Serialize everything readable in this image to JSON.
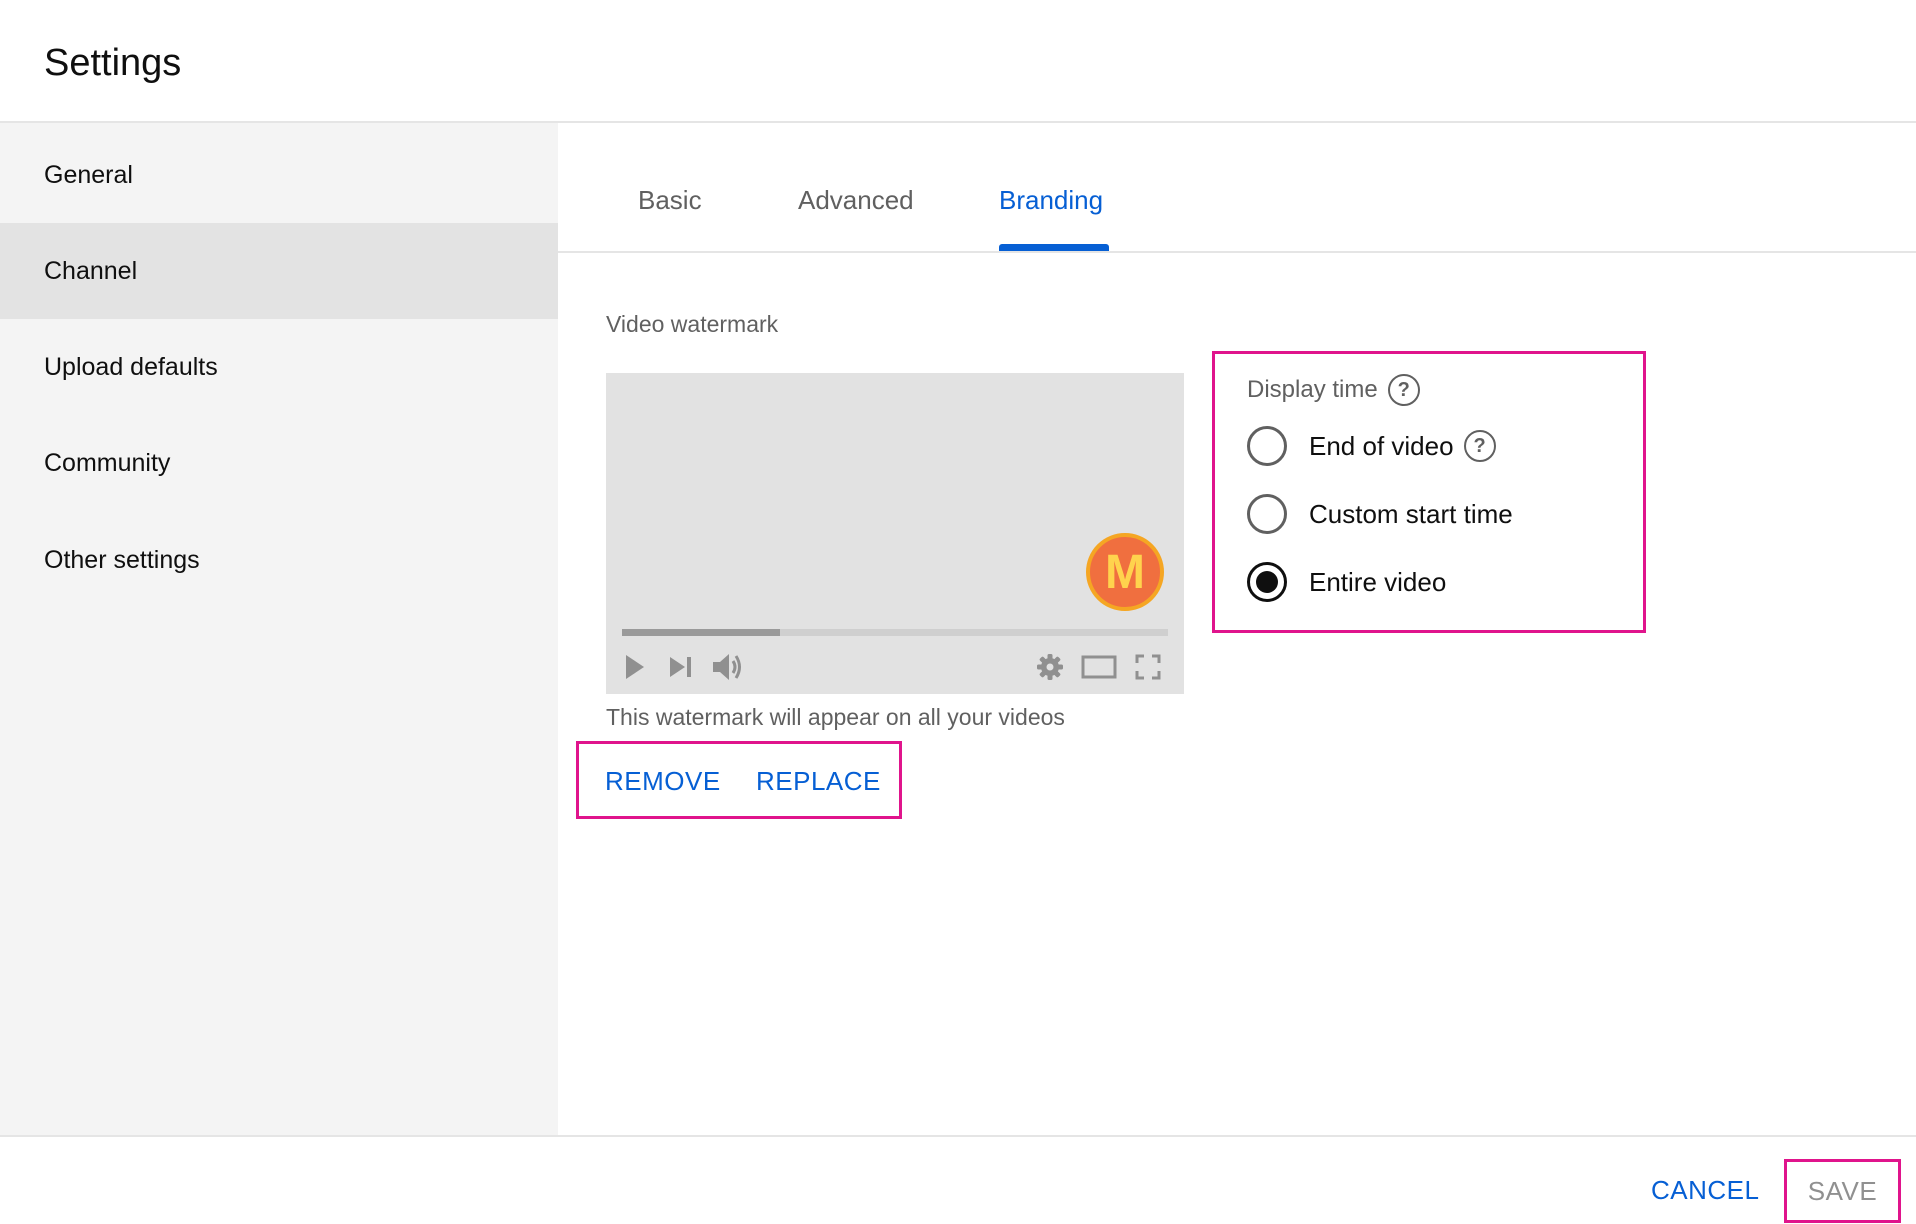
{
  "header": {
    "title": "Settings"
  },
  "sidebar": {
    "items": [
      {
        "label": "General"
      },
      {
        "label": "Channel"
      },
      {
        "label": "Upload defaults"
      },
      {
        "label": "Community"
      },
      {
        "label": "Other settings"
      }
    ],
    "active_index": 1
  },
  "tabs": [
    {
      "label": "Basic"
    },
    {
      "label": "Advanced"
    },
    {
      "label": "Branding"
    }
  ],
  "active_tab": "Branding",
  "watermark": {
    "section_label": "Video watermark",
    "logo_letter": "M",
    "caption": "This watermark will appear on all your videos",
    "remove_label": "REMOVE",
    "replace_label": "REPLACE",
    "player_progress_fraction": 0.29
  },
  "display_time": {
    "label": "Display time",
    "options": [
      {
        "label": "End of video",
        "checked": false
      },
      {
        "label": "Custom start time",
        "checked": false
      },
      {
        "label": "Entire video",
        "checked": true
      }
    ]
  },
  "footer": {
    "cancel_label": "CANCEL",
    "save_label": "SAVE"
  },
  "colors": {
    "accent": "#065fd4",
    "highlight": "#e0148c",
    "sidebar_bg": "#f4f4f4",
    "active_nav_bg": "#e3e3e3"
  },
  "icons": [
    "help-icon",
    "play-icon",
    "skip-next-icon",
    "volume-icon",
    "settings-gear-icon",
    "theater-mode-icon",
    "fullscreen-icon"
  ]
}
